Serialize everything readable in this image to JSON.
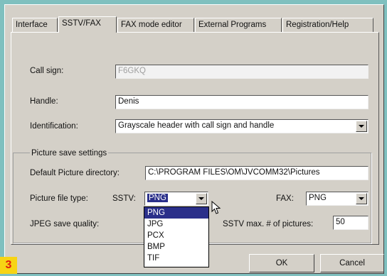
{
  "tabs": [
    {
      "label": "Interface"
    },
    {
      "label": "SSTV/FAX"
    },
    {
      "label": "FAX mode editor"
    },
    {
      "label": "External Programs"
    },
    {
      "label": "Registration/Help"
    }
  ],
  "active_tab": "SSTV/FAX",
  "form": {
    "call_sign_label": "Call sign:",
    "call_sign_value": "F6GKQ",
    "handle_label": "Handle:",
    "handle_value": "Denis",
    "identification_label": "Identification:",
    "identification_value": "Grayscale header with call sign and handle"
  },
  "picture_settings": {
    "group_title": "Picture save settings",
    "dir_label": "Default Picture directory:",
    "dir_value": "C:\\PROGRAM FILES\\OM\\JVCOMM32\\Pictures",
    "file_type_label": "Picture file type:",
    "sstv_label": "SSTV:",
    "sstv_selected": "PNG",
    "sstv_options": [
      "PNG",
      "JPG",
      "PCX",
      "BMP",
      "TIF"
    ],
    "fax_label": "FAX:",
    "fax_value": "PNG",
    "jpeg_label": "JPEG save quality:",
    "sstv_max_label": "SSTV max. # of pictures:",
    "sstv_max_value": "50"
  },
  "buttons": {
    "ok": "OK",
    "cancel": "Cancel"
  },
  "badge": "3",
  "colors": {
    "background": "#7fc0bf",
    "dialog": "#d4d0c8",
    "selection": "#2a2f8a",
    "badge_bg": "#f7d414",
    "badge_fg": "#e0200d"
  }
}
